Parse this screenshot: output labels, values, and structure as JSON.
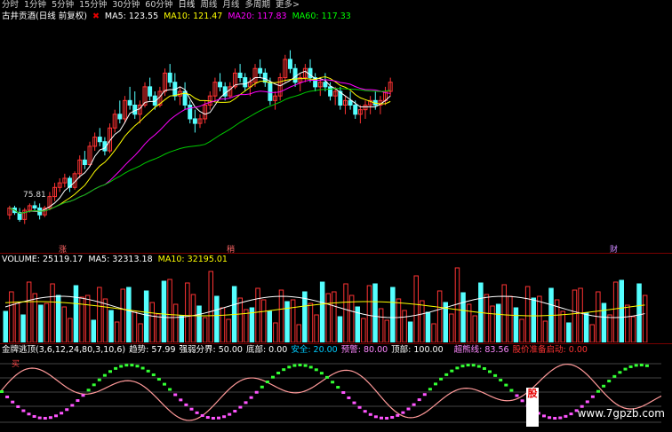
{
  "toolbar": {
    "timeframes": [
      "分时",
      "1分钟",
      "5分钟",
      "15分钟",
      "30分钟",
      "60分钟",
      "日线",
      "周线",
      "月线",
      "多周期",
      "更多>"
    ],
    "active": "日线"
  },
  "price_pane": {
    "title": "古井贡酒(日线 前复权)",
    "ma5": "MA5: 123.55",
    "ma10": "MA10: 121.47",
    "ma20": "MA20: 117.83",
    "ma60": "MA60: 117.33",
    "low_label": "75.81",
    "markers": [
      "涨",
      "稍",
      "财"
    ],
    "colors": {
      "ma5": "#ffffff",
      "ma10": "#ffff00",
      "ma20": "#ff00ff",
      "ma60": "#00cc00",
      "up": "#ff3333",
      "down": "#54ffff"
    }
  },
  "volume_pane": {
    "title": "VOLUME: 25119.17",
    "ma5": "MA5: 32313.18",
    "ma10": "MA10: 32195.01"
  },
  "indicator_pane": {
    "title": "金牌逃顶(3,6,12,24,80,3,10,6)",
    "trend": "趋势: 57.99",
    "split": "强弱分界: 50.00",
    "bottom": "底部: 0.00",
    "safe": "安全: 20.00",
    "warn": "预警: 80.00",
    "top": "顶部: 100.00",
    "overbuy": "超熊线: 83.56",
    "surge": "股价准备启动: 0.00",
    "buy_label": "买"
  },
  "corner_logo": "股",
  "watermark": "www.7gpzb.com",
  "chart_data": {
    "type": "candlestick",
    "candles": [
      [
        30,
        34,
        28,
        33
      ],
      [
        33,
        34,
        30,
        31
      ],
      [
        31,
        33,
        27,
        28
      ],
      [
        28,
        33,
        26,
        32
      ],
      [
        32,
        35,
        31,
        34
      ],
      [
        34,
        36,
        32,
        33
      ],
      [
        33,
        35,
        28,
        30
      ],
      [
        30,
        34,
        29,
        33
      ],
      [
        33,
        40,
        32,
        38
      ],
      [
        38,
        44,
        36,
        42
      ],
      [
        42,
        46,
        40,
        44
      ],
      [
        44,
        48,
        42,
        46
      ],
      [
        46,
        47,
        40,
        42
      ],
      [
        42,
        49,
        41,
        48
      ],
      [
        48,
        56,
        46,
        54
      ],
      [
        54,
        58,
        50,
        52
      ],
      [
        52,
        62,
        51,
        60
      ],
      [
        60,
        66,
        58,
        64
      ],
      [
        64,
        68,
        60,
        62
      ],
      [
        62,
        64,
        56,
        58
      ],
      [
        58,
        70,
        57,
        68
      ],
      [
        68,
        76,
        66,
        74
      ],
      [
        74,
        80,
        70,
        72
      ],
      [
        72,
        82,
        70,
        80
      ],
      [
        80,
        86,
        76,
        78
      ],
      [
        78,
        84,
        72,
        74
      ],
      [
        74,
        80,
        70,
        78
      ],
      [
        78,
        88,
        77,
        86
      ],
      [
        86,
        90,
        80,
        82
      ],
      [
        82,
        84,
        76,
        78
      ],
      [
        78,
        86,
        77,
        84
      ],
      [
        84,
        94,
        82,
        92
      ],
      [
        92,
        96,
        86,
        88
      ],
      [
        88,
        92,
        80,
        82
      ],
      [
        82,
        86,
        78,
        84
      ],
      [
        84,
        88,
        76,
        78
      ],
      [
        78,
        80,
        70,
        72
      ],
      [
        72,
        76,
        66,
        70
      ],
      [
        70,
        74,
        68,
        72
      ],
      [
        72,
        80,
        70,
        78
      ],
      [
        78,
        84,
        76,
        82
      ],
      [
        82,
        90,
        80,
        88
      ],
      [
        88,
        92,
        84,
        86
      ],
      [
        86,
        88,
        80,
        82
      ],
      [
        82,
        88,
        81,
        86
      ],
      [
        86,
        94,
        85,
        92
      ],
      [
        92,
        96,
        88,
        90
      ],
      [
        90,
        92,
        84,
        86
      ],
      [
        86,
        90,
        82,
        88
      ],
      [
        88,
        96,
        86,
        94
      ],
      [
        94,
        98,
        90,
        92
      ],
      [
        92,
        94,
        86,
        88
      ],
      [
        88,
        90,
        78,
        80
      ],
      [
        80,
        84,
        76,
        82
      ],
      [
        82,
        92,
        80,
        90
      ],
      [
        90,
        100,
        88,
        98
      ],
      [
        98,
        102,
        92,
        94
      ],
      [
        94,
        96,
        86,
        88
      ],
      [
        88,
        92,
        84,
        90
      ],
      [
        90,
        96,
        88,
        94
      ],
      [
        94,
        98,
        88,
        90
      ],
      [
        90,
        92,
        84,
        86
      ],
      [
        86,
        90,
        82,
        88
      ],
      [
        88,
        92,
        84,
        86
      ],
      [
        86,
        88,
        80,
        82
      ],
      [
        82,
        86,
        78,
        84
      ],
      [
        84,
        86,
        76,
        78
      ],
      [
        78,
        82,
        74,
        80
      ],
      [
        80,
        84,
        76,
        78
      ],
      [
        78,
        80,
        72,
        74
      ],
      [
        74,
        78,
        70,
        76
      ],
      [
        76,
        80,
        72,
        78
      ],
      [
        78,
        82,
        74,
        80
      ],
      [
        80,
        84,
        76,
        78
      ],
      [
        78,
        82,
        74,
        80
      ],
      [
        80,
        86,
        78,
        84
      ],
      [
        84,
        90,
        82,
        88
      ]
    ]
  }
}
